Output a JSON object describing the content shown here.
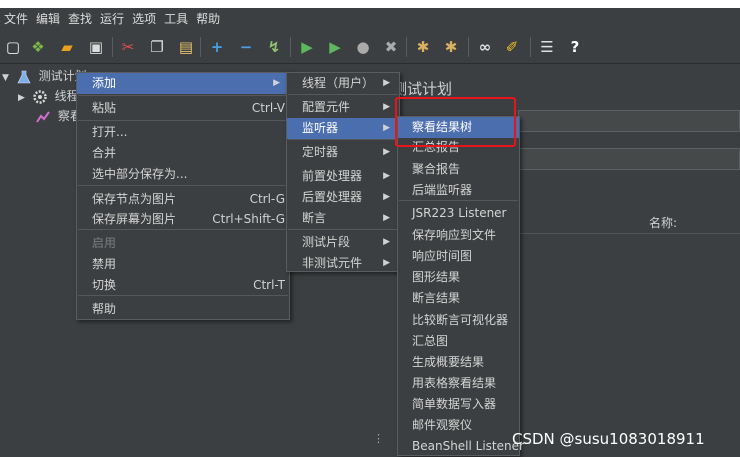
{
  "menubar": [
    "文件",
    "编辑",
    "查找",
    "运行",
    "选项",
    "工具",
    "帮助"
  ],
  "toolbar_icons": [
    {
      "name": "new-icon",
      "glyph": "▢",
      "color": "#f0f0f0"
    },
    {
      "name": "templates-icon",
      "glyph": "❖",
      "color": "#7ab648"
    },
    {
      "name": "open-icon",
      "glyph": "▰",
      "color": "#e8a21c"
    },
    {
      "name": "save-icon",
      "glyph": "▣",
      "color": "#dcdcdc"
    },
    {
      "name": "cut-icon",
      "glyph": "✂",
      "color": "#e05050"
    },
    {
      "name": "copy-icon",
      "glyph": "❐",
      "color": "#dcdcdc"
    },
    {
      "name": "paste-icon",
      "glyph": "▤",
      "color": "#e8c36a"
    },
    {
      "name": "expand-icon",
      "glyph": "+",
      "color": "#4a9fe0"
    },
    {
      "name": "collapse-icon",
      "glyph": "−",
      "color": "#4a9fe0"
    },
    {
      "name": "toggle-icon",
      "glyph": "↯",
      "color": "#8fc370"
    },
    {
      "name": "start-icon",
      "glyph": "▶",
      "color": "#5cb85c"
    },
    {
      "name": "start-no-pauses-icon",
      "glyph": "▶",
      "color": "#5cb85c"
    },
    {
      "name": "stop-icon",
      "glyph": "●",
      "color": "#aaaaaa"
    },
    {
      "name": "shutdown-icon",
      "glyph": "✖",
      "color": "#aaaaaa"
    },
    {
      "name": "clear-icon",
      "glyph": "✱",
      "color": "#d8b060"
    },
    {
      "name": "clear-all-icon",
      "glyph": "✱",
      "color": "#d8b060"
    },
    {
      "name": "search-icon",
      "glyph": "∞",
      "color": "#e0e0e0"
    },
    {
      "name": "reset-search-icon",
      "glyph": "✐",
      "color": "#f0c020"
    },
    {
      "name": "function-helper-icon",
      "glyph": "☰",
      "color": "#e0e0e0"
    },
    {
      "name": "help-icon",
      "glyph": "?",
      "color": "#ffffff"
    }
  ],
  "tree": {
    "root": "测试计划",
    "child1": "线程",
    "child2": "察看"
  },
  "right_panel": {
    "title": "测试计划",
    "col_header": "名称:"
  },
  "context_menu": [
    {
      "label": "添加",
      "shortcut": "",
      "submenu": true,
      "highlight": true,
      "disabled": false
    },
    {
      "label": "粘贴",
      "shortcut": "Ctrl-V",
      "submenu": false,
      "highlight": false,
      "disabled": false
    },
    {
      "label": "打开...",
      "shortcut": "",
      "submenu": false,
      "highlight": false,
      "disabled": false
    },
    {
      "label": "合并",
      "shortcut": "",
      "submenu": false,
      "highlight": false,
      "disabled": false
    },
    {
      "label": "选中部分保存为...",
      "shortcut": "",
      "submenu": false,
      "highlight": false,
      "disabled": false
    },
    {
      "label": "保存节点为图片",
      "shortcut": "Ctrl-G",
      "submenu": false,
      "highlight": false,
      "disabled": false
    },
    {
      "label": "保存屏幕为图片",
      "shortcut": "Ctrl+Shift-G",
      "submenu": false,
      "highlight": false,
      "disabled": false
    },
    {
      "label": "启用",
      "shortcut": "",
      "submenu": false,
      "highlight": false,
      "disabled": true
    },
    {
      "label": "禁用",
      "shortcut": "",
      "submenu": false,
      "highlight": false,
      "disabled": false
    },
    {
      "label": "切换",
      "shortcut": "Ctrl-T",
      "submenu": false,
      "highlight": false,
      "disabled": false
    },
    {
      "label": "帮助",
      "shortcut": "",
      "submenu": false,
      "highlight": false,
      "disabled": false
    }
  ],
  "add_submenu": [
    {
      "label": "线程（用户）",
      "highlight": false
    },
    {
      "label": "配置元件",
      "highlight": false
    },
    {
      "label": "监听器",
      "highlight": true
    },
    {
      "label": "定时器",
      "highlight": false
    },
    {
      "label": "前置处理器",
      "highlight": false
    },
    {
      "label": "后置处理器",
      "highlight": false
    },
    {
      "label": "断言",
      "highlight": false
    },
    {
      "label": "测试片段",
      "highlight": false
    },
    {
      "label": "非测试元件",
      "highlight": false
    }
  ],
  "listener_submenu": [
    {
      "label": "察看结果树",
      "highlight": true
    },
    {
      "label": "汇总报告",
      "highlight": false
    },
    {
      "label": "聚合报告",
      "highlight": false
    },
    {
      "label": "后端监听器",
      "highlight": false
    },
    {
      "label": "JSR223 Listener",
      "highlight": false
    },
    {
      "label": "保存响应到文件",
      "highlight": false
    },
    {
      "label": "响应时间图",
      "highlight": false
    },
    {
      "label": "图形结果",
      "highlight": false
    },
    {
      "label": "断言结果",
      "highlight": false
    },
    {
      "label": "比较断言可视化器",
      "highlight": false
    },
    {
      "label": "汇总图",
      "highlight": false
    },
    {
      "label": "生成概要结果",
      "highlight": false
    },
    {
      "label": "用表格察看结果",
      "highlight": false
    },
    {
      "label": "简单数据写入器",
      "highlight": false
    },
    {
      "label": "邮件观察仪",
      "highlight": false
    },
    {
      "label": "BeanShell Listener",
      "highlight": false
    }
  ],
  "watermark": "CSDN @susu1083018911"
}
